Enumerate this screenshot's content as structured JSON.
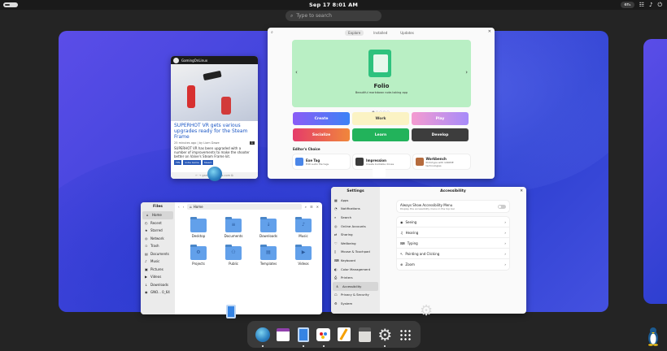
{
  "topbar": {
    "clock": "Sep 17   8:01 AM",
    "lang": "en₁",
    "icons": [
      "network-icon",
      "volume-icon",
      "power-icon"
    ]
  },
  "search": {
    "placeholder": "Type to search",
    "icon": "search-icon"
  },
  "browser": {
    "site": "GamingOnLinux",
    "headline": "SUPERHOT VR gets various upgrades ready for the Steam Frame",
    "meta": "25 minutes ago | by Liam Dawe",
    "comments": "1",
    "body": "SUPERHOT VR has been upgraded with a number of improvements to make the shooter better on Valve's Steam Frame kit.",
    "tags": [
      "FPS",
      "Indie Game",
      "Steam"
    ],
    "footer": "← →  gamingonlinux.com  ⧉"
  },
  "software": {
    "tabs": [
      "Explore",
      "Installed",
      "Updates"
    ],
    "banner_title": "Folio",
    "banner_sub": "Beautiful markdown note-taking app",
    "categories": [
      "Create",
      "Work",
      "Play",
      "Socialize",
      "Learn",
      "Develop"
    ],
    "editors_choice": "Editor's Choice",
    "picks": [
      {
        "title": "Exe Tag",
        "sub": "Edit audio file tags",
        "color": "#4a86e8"
      },
      {
        "title": "Impression",
        "sub": "Create bootable drives",
        "color": "#3a3a3a"
      },
      {
        "title": "Workbench",
        "sub": "Prototype with GNOME technologies",
        "color": "#b56b3d"
      }
    ]
  },
  "files": {
    "title": "Files",
    "path": "Home",
    "sidebar": [
      {
        "label": "Home",
        "icon": "⌂",
        "selected": true
      },
      {
        "label": "Recent",
        "icon": "◴"
      },
      {
        "label": "Starred",
        "icon": "★"
      },
      {
        "label": "Network",
        "icon": "◎"
      },
      {
        "label": "Trash",
        "icon": "♲"
      },
      {
        "label": "Documents",
        "icon": "▤"
      },
      {
        "label": "Music",
        "icon": "♪"
      },
      {
        "label": "Pictures",
        "icon": "▣"
      },
      {
        "label": "Videos",
        "icon": "▶"
      },
      {
        "label": "Downloads",
        "icon": "↓"
      },
      {
        "label": "GNO... 0_64",
        "icon": "◉"
      }
    ],
    "folders": [
      {
        "label": "Desktop",
        "glyph": ""
      },
      {
        "label": "Documents",
        "glyph": "≡"
      },
      {
        "label": "Downloads",
        "glyph": "↓"
      },
      {
        "label": "Music",
        "glyph": "♪"
      },
      {
        "label": "Pictures",
        "glyph": "▣"
      },
      {
        "label": "Projects",
        "glyph": "⚙"
      },
      {
        "label": "Public",
        "glyph": "⚇"
      },
      {
        "label": "Templates",
        "glyph": "▤"
      },
      {
        "label": "Videos",
        "glyph": "▶"
      }
    ]
  },
  "settings": {
    "title": "Settings",
    "page": "Accessibility",
    "sidebar": [
      {
        "label": "Apps",
        "icon": "▦"
      },
      {
        "label": "Notifications",
        "icon": "◔"
      },
      {
        "label": "Search",
        "icon": "⌕"
      },
      {
        "label": "Online Accounts",
        "icon": "◎"
      },
      {
        "label": "Sharing",
        "icon": "⇄"
      },
      {
        "label": "Wellbeing",
        "icon": "♡"
      },
      {
        "label": "Mouse & Touchpad",
        "icon": "▯"
      },
      {
        "label": "Keyboard",
        "icon": "⌨"
      },
      {
        "label": "Color Management",
        "icon": "◐"
      },
      {
        "label": "Printers",
        "icon": "⎙"
      },
      {
        "label": "Accessibility",
        "icon": "♿",
        "selected": true
      },
      {
        "label": "Privacy & Security",
        "icon": "☖"
      },
      {
        "label": "System",
        "icon": "⚙"
      }
    ],
    "menu_toggle_label": "Always Show Accessibility Menu",
    "menu_toggle_sub": "Display the accessibility menu in the top bar",
    "rows": [
      {
        "label": "Seeing",
        "icon": "◉"
      },
      {
        "label": "Hearing",
        "icon": "♫"
      },
      {
        "label": "Typing",
        "icon": "⌨"
      },
      {
        "label": "Pointing and Clicking",
        "icon": "↖"
      },
      {
        "label": "Zoom",
        "icon": "⊕"
      }
    ]
  },
  "dock": {
    "apps": [
      {
        "name": "web-browser-icon",
        "running": true
      },
      {
        "name": "calendar-icon",
        "running": false
      },
      {
        "name": "files-icon",
        "running": true
      },
      {
        "name": "software-icon",
        "running": true
      },
      {
        "name": "text-editor-icon",
        "running": false
      },
      {
        "name": "calculator-icon",
        "running": false
      },
      {
        "name": "settings-icon",
        "running": true
      },
      {
        "name": "show-apps-icon",
        "running": false
      }
    ]
  }
}
